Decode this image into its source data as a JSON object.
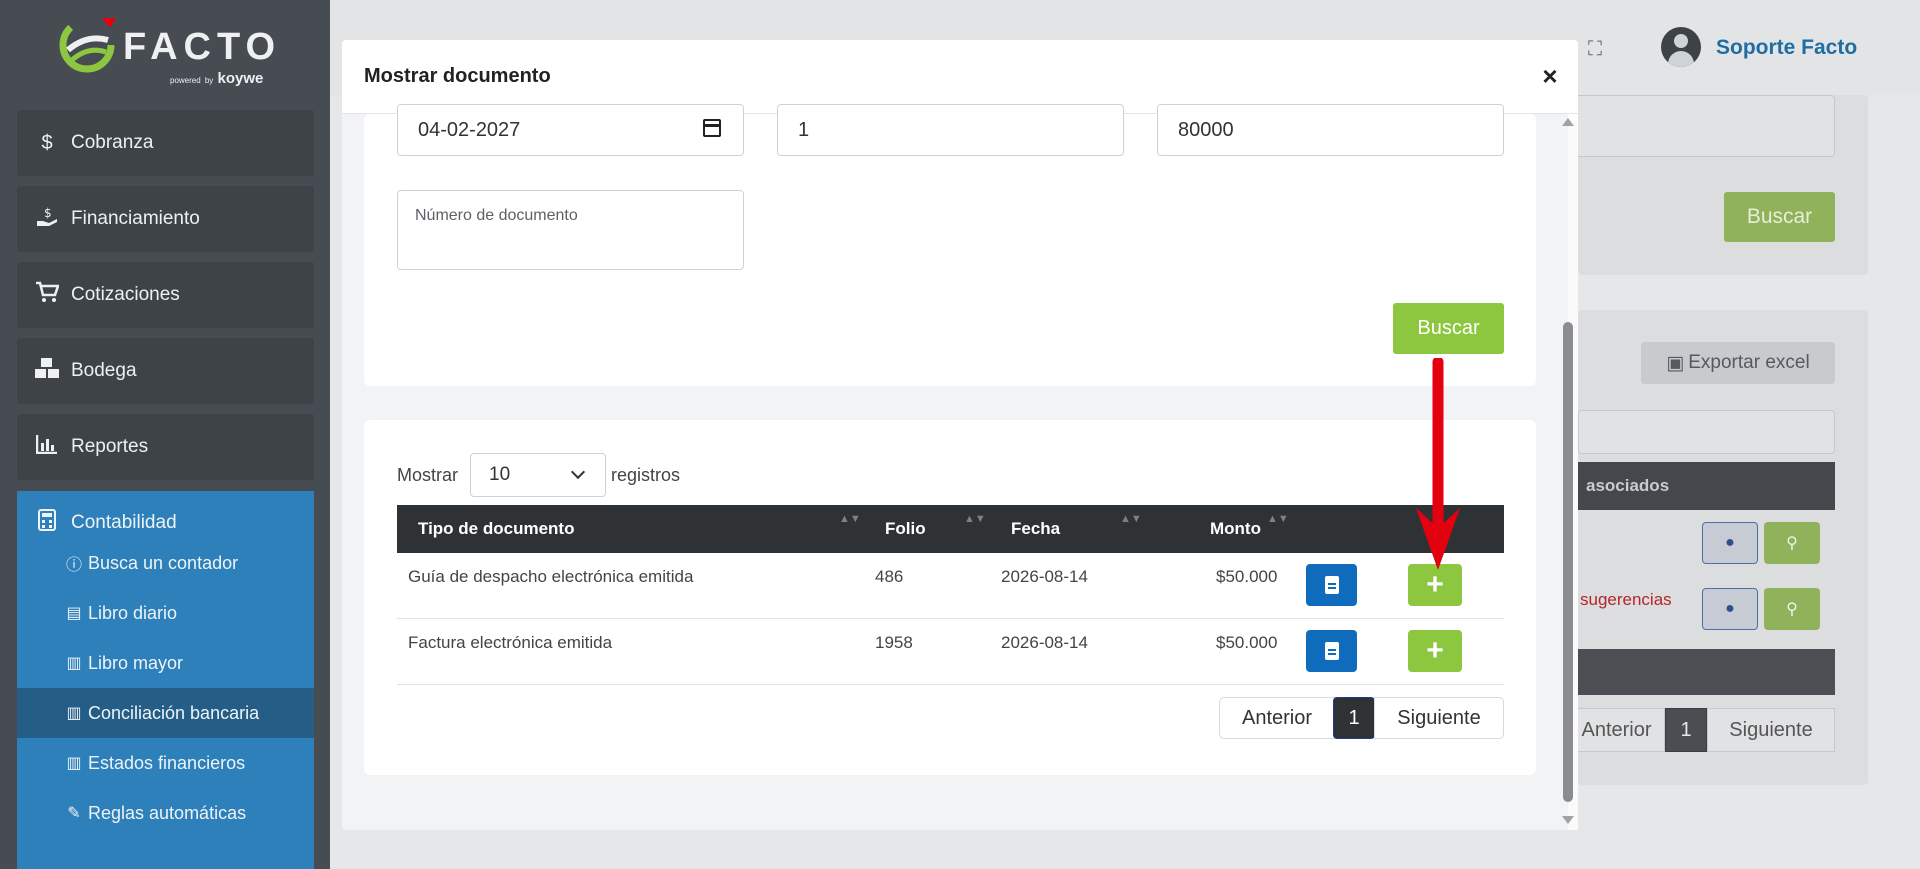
{
  "brand": {
    "name": "FACTO",
    "powered_prefix": "powered",
    "powered_by": "by",
    "partner": "koywe"
  },
  "sidebar": {
    "items": [
      {
        "label": "Cobranza",
        "icon": "dollar-icon"
      },
      {
        "label": "Financiamiento",
        "icon": "hand-money-icon"
      },
      {
        "label": "Cotizaciones",
        "icon": "cart-icon"
      },
      {
        "label": "Bodega",
        "icon": "boxes-icon"
      },
      {
        "label": "Reportes",
        "icon": "chart-icon"
      }
    ],
    "group": {
      "label": "Contabilidad",
      "icon": "calculator-icon",
      "children": [
        {
          "label": "Busca un contador",
          "icon": "info-icon"
        },
        {
          "label": "Libro diario",
          "icon": "file-icon"
        },
        {
          "label": "Libro mayor",
          "icon": "book-icon"
        },
        {
          "label": "Conciliación bancaria",
          "icon": "book-icon",
          "active": true
        },
        {
          "label": "Estados financieros",
          "icon": "book-icon"
        },
        {
          "label": "Reglas automáticas",
          "icon": "tools-icon"
        }
      ]
    }
  },
  "topbar": {
    "user_name": "Soporte Facto"
  },
  "background": {
    "search_button": "Buscar",
    "export_button": "Exportar excel",
    "table_header_fragment": "asociados",
    "suggestion_fragment": "sugerencias",
    "pagination": {
      "prev": "Anterior",
      "current": "1",
      "next": "Siguiente"
    }
  },
  "modal": {
    "title": "Mostrar documento",
    "close": "×",
    "filters": {
      "date_value": "04-02-2027",
      "field2_value": "1",
      "amount_value": "80000",
      "doc_number_label": "Número de documento",
      "search_button": "Buscar"
    },
    "table": {
      "length_prefix": "Mostrar",
      "length_value": "10",
      "length_suffix": "registros",
      "columns": [
        "Tipo de documento",
        "Folio",
        "Fecha",
        "Monto"
      ],
      "rows": [
        {
          "tipo": "Guía de despacho electrónica emitida",
          "folio": "486",
          "fecha": "2026-08-14",
          "monto": "$50.000"
        },
        {
          "tipo": "Factura electrónica emitida",
          "folio": "1958",
          "fecha": "2026-08-14",
          "monto": "$50.000"
        }
      ],
      "add_symbol": "+",
      "pagination": {
        "prev": "Anterior",
        "current": "1",
        "next": "Siguiente"
      }
    }
  },
  "colors": {
    "sidebar_bg": "#474c52",
    "active_group": "#2e80ba",
    "green": "#8dc63f",
    "blue": "#0f6cbd",
    "arrow": "#e3000f"
  }
}
